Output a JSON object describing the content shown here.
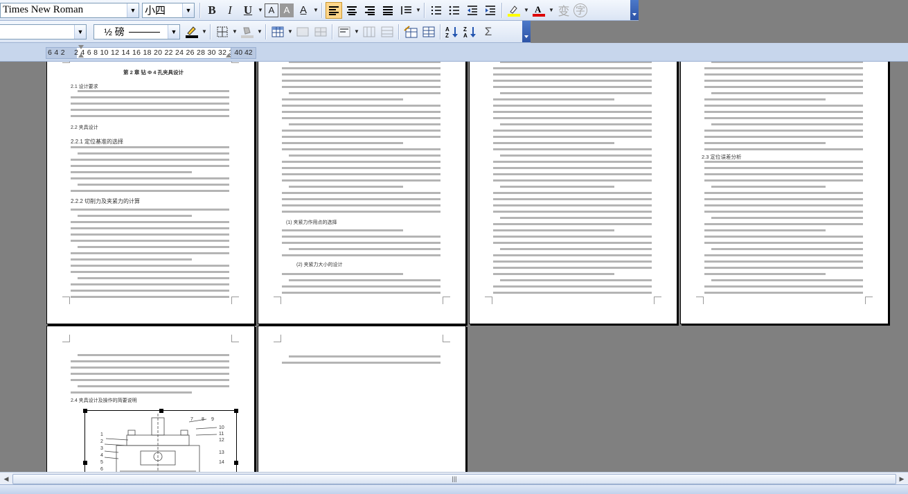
{
  "toolbar1": {
    "font_name": "Times New Roman",
    "font_size": "小四"
  },
  "toolbar2": {
    "style_value": "",
    "line_weight": "½ 磅"
  },
  "ruler": {
    "left_text": "6 4 2",
    "main_text": "2  4  6  8 10 12 14 16 18 20 22 24 26 28 30 32 34",
    "right_text": "40 42"
  },
  "pages": [
    {
      "heading": "第 2 章  钻 Φ 4 孔夹具设计",
      "sections": [
        "2.1 设计要求",
        "2.2 夹具设计",
        "2.2.1  定位基准的选择",
        "2.2.2  切削力及夹紧力的计算"
      ]
    },
    {
      "sections": [
        "(1)  夹紧力作用点的选择",
        "(2)  夹紧力大小的设计"
      ]
    },
    {
      "sections": []
    },
    {
      "sections": [
        "2.3 定位误差分析"
      ]
    },
    {
      "sections": [
        "2.4 夹具设计及操作的简要说明"
      ],
      "drawing_labels": [
        "7",
        "8",
        "9",
        "10",
        "11",
        "12",
        "13",
        "14",
        "1",
        "2",
        "3",
        "4",
        "5",
        "6"
      ]
    },
    {
      "sections": []
    }
  ],
  "colors": {
    "toolbar_bg": "#dbe5f4",
    "workspace": "#808080",
    "active_button": "#ffd68a"
  }
}
